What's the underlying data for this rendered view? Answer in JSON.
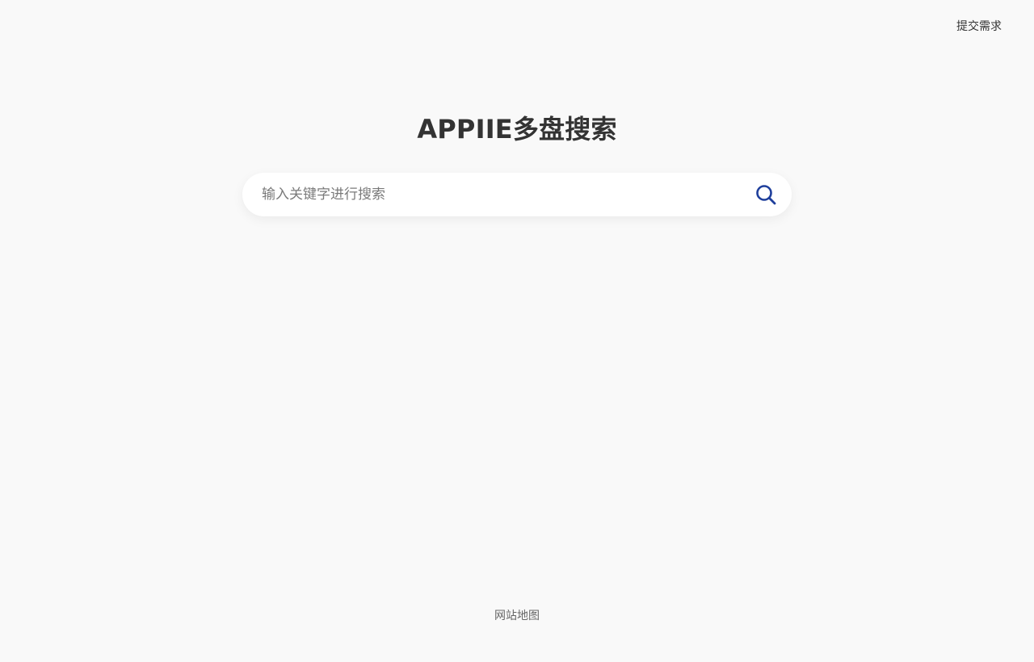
{
  "header": {
    "submit_request_label": "提交需求"
  },
  "hero": {
    "title": "APPIIE多盘搜索"
  },
  "search": {
    "placeholder": "输入关键字进行搜索",
    "value": "",
    "button_icon": "search-icon"
  },
  "footer": {
    "sitemap_label": "网站地图"
  },
  "colors": {
    "background": "#f9f9f9",
    "text": "#333333",
    "accent": "#1f3f9c"
  }
}
